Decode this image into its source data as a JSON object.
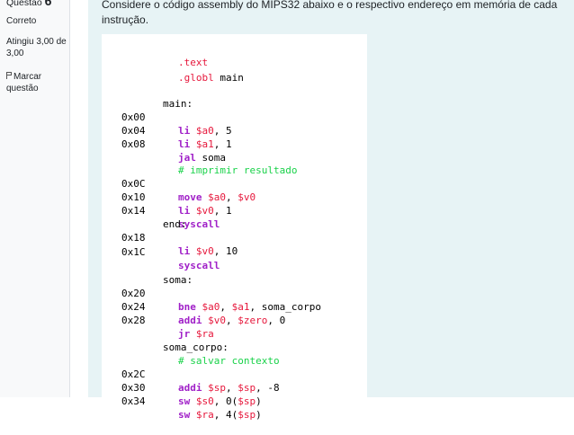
{
  "info": {
    "question_label": "Questão",
    "question_number": "6",
    "state": "Correto",
    "grade": "Atingiu 3,00 de 3,00",
    "flag_label": "Marcar questão",
    "flag_icon": "flag-icon"
  },
  "question": {
    "text": "Considere o código assembly do MIPS32 abaixo e o respectivo endereço em memória de cada instrução."
  },
  "colors": {
    "directive": "#e6183c",
    "comment": "#1ad24a",
    "keyword": "#a020c8",
    "register": "#e6183c",
    "panel_bg": "#e7f3f5"
  },
  "code": {
    "l1": {
      "dir": ".text"
    },
    "l2": {
      "dir": ".globl",
      "rest": " main"
    },
    "l3": {
      "label": "main:"
    },
    "l4": {
      "addr": "0x00",
      "op": "li",
      "r1": "$a0",
      "rest": ", 5"
    },
    "l5": {
      "addr": "0x04",
      "op": "li",
      "r1": "$a1",
      "rest": ", 1"
    },
    "l6": {
      "addr": "0x08",
      "op": "jal",
      "rest": " soma"
    },
    "l7": {
      "comment": "# imprimir resultado"
    },
    "l8": {
      "addr": "0x0C",
      "op": "move",
      "r1": "$a0",
      "sep": ", ",
      "r2": "$v0"
    },
    "l9": {
      "addr": "0x10",
      "op": "li",
      "r1": "$v0",
      "rest": ", 1"
    },
    "l10": {
      "addr": "0x14",
      "op": "syscall"
    },
    "l11": {
      "label": "end:"
    },
    "l12": {
      "addr": "0x18",
      "op": "li",
      "r1": "$v0",
      "rest": ", 10"
    },
    "l13": {
      "addr": "0x1C",
      "op": "syscall"
    },
    "l14": {
      "label": "soma:"
    },
    "l15": {
      "addr": "0x20",
      "op": "bne",
      "r1": "$a0",
      "sep": ", ",
      "r2": "$a1",
      "rest": ", soma_corpo"
    },
    "l16": {
      "addr": "0x24",
      "op": "addi",
      "r1": "$v0",
      "sep": ", ",
      "r2": "$zero",
      "rest": ", 0"
    },
    "l17": {
      "addr": "0x28",
      "op": "jr",
      "r1": "$ra"
    },
    "l18": {
      "label": "soma_corpo:"
    },
    "l19": {
      "comment": "# salvar contexto"
    },
    "l20": {
      "addr": "0x2C",
      "op": "addi",
      "r1": "$sp",
      "sep": ", ",
      "r2": "$sp",
      "rest": ", -8"
    },
    "l21": {
      "addr": "0x30",
      "op": "sw",
      "r1": "$s0",
      "rest": ", 0(",
      "r2": "$sp",
      "tail": ")"
    },
    "l22": {
      "addr": "0x34",
      "op": "sw",
      "r1": "$ra",
      "rest": ", 4(",
      "r2": "$sp",
      "tail": ")"
    }
  }
}
